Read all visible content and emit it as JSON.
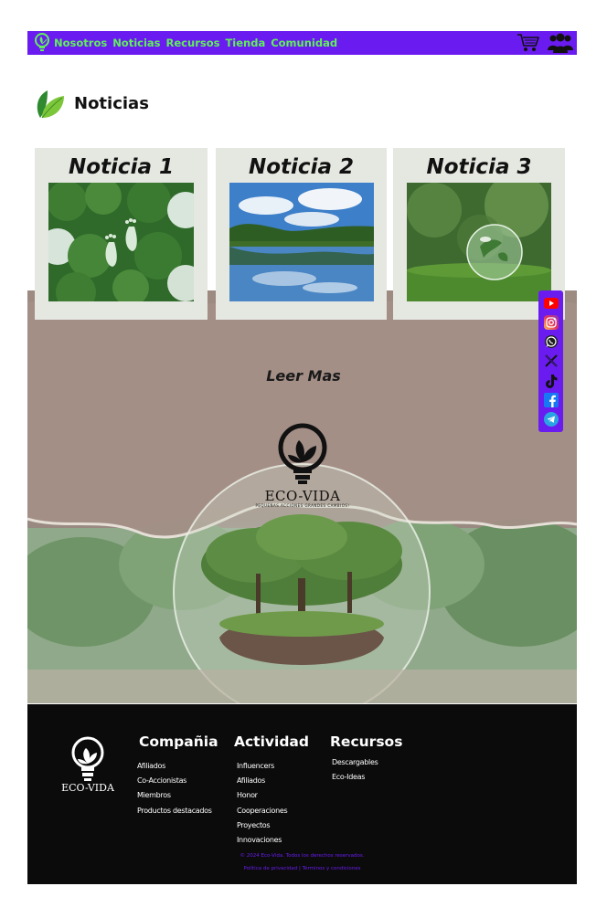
{
  "nav": {
    "links": [
      "Nosotros",
      "Noticias",
      "Recursos",
      "Tienda",
      "Comunidad"
    ],
    "colors": {
      "background": "#6a1cf0",
      "link": "#5ff05a"
    },
    "icons": [
      "lightbulb-leaf-icon",
      "cart-icon",
      "users-icon"
    ]
  },
  "page": {
    "title": "Noticias"
  },
  "cards": [
    {
      "title": "Noticia 1",
      "image": "forest-footprints-image"
    },
    {
      "title": "Noticia 2",
      "image": "lake-reflection-image"
    },
    {
      "title": "Noticia 3",
      "image": "glass-globe-moss-image"
    }
  ],
  "read_more": "Leer Mas",
  "brand": {
    "name": "ECO-VIDA",
    "tagline": "PEQUEÑAS ACCIONES GRANDES CAMBIOS!"
  },
  "social": [
    "youtube-icon",
    "instagram-icon",
    "whatsapp-icon",
    "x-icon",
    "tiktok-icon",
    "facebook-icon",
    "telegram-icon"
  ],
  "footer": {
    "logo_name": "ECO-VIDA",
    "columns": [
      {
        "title": "Compañia",
        "items": [
          "Afiliados",
          "Co-Accionistas",
          "Miembros",
          "Productos destacados"
        ]
      },
      {
        "title": "Actividad",
        "items": [
          "Influencers",
          "Afiliados",
          "Honor",
          "Cooperaciones",
          "Proyectos",
          "Innovaciones"
        ]
      },
      {
        "title": "Recursos",
        "items": [
          "Descargables",
          "Eco-Ideas"
        ]
      }
    ],
    "copyright": "© 2024 Eco-Vida. Todos los derechos reservados.",
    "privacy": "Política de privacidad",
    "separator": "|",
    "terms": "Términos y condiciones"
  }
}
